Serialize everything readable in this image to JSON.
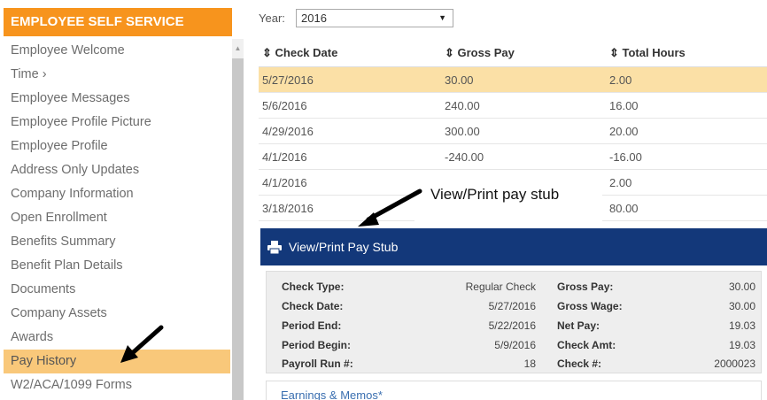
{
  "sidebar": {
    "title": "EMPLOYEE SELF SERVICE",
    "items": [
      {
        "label": "Employee Welcome"
      },
      {
        "label": "Time ›"
      },
      {
        "label": "Employee Messages"
      },
      {
        "label": "Employee Profile Picture"
      },
      {
        "label": "Employee Profile"
      },
      {
        "label": "Address Only Updates"
      },
      {
        "label": "Company Information"
      },
      {
        "label": "Open Enrollment"
      },
      {
        "label": "Benefits Summary"
      },
      {
        "label": "Benefit Plan Details"
      },
      {
        "label": "Documents"
      },
      {
        "label": "Company Assets"
      },
      {
        "label": "Awards"
      },
      {
        "label": "Pay History"
      },
      {
        "label": "W2/ACA/1099 Forms"
      }
    ],
    "active_index": 13
  },
  "filter": {
    "year_label": "Year:",
    "year_value": "2016"
  },
  "table": {
    "headers": [
      "⇕ Check Date",
      "⇕ Gross Pay",
      "⇕ Total Hours"
    ],
    "rows": [
      {
        "date": "5/27/2016",
        "gross": "30.00",
        "hours": "2.00"
      },
      {
        "date": "5/6/2016",
        "gross": "240.00",
        "hours": "16.00"
      },
      {
        "date": "4/29/2016",
        "gross": "300.00",
        "hours": "20.00"
      },
      {
        "date": "4/1/2016",
        "gross": "-240.00",
        "hours": "-16.00"
      },
      {
        "date": "4/1/2016",
        "gross": "",
        "hours": "2.00"
      },
      {
        "date": "3/18/2016",
        "gross": "",
        "hours": "80.00"
      }
    ]
  },
  "callout": {
    "text": "View/Print pay stub"
  },
  "stub": {
    "button_label": "View/Print Pay Stub"
  },
  "details": {
    "left": [
      {
        "label": "Check Type:",
        "value": "Regular Check"
      },
      {
        "label": "Check Date:",
        "value": "5/27/2016"
      },
      {
        "label": "Period End:",
        "value": "5/22/2016"
      },
      {
        "label": "Period Begin:",
        "value": "5/9/2016"
      },
      {
        "label": "Payroll Run #:",
        "value": "18"
      }
    ],
    "right": [
      {
        "label": "Gross Pay:",
        "value": "30.00"
      },
      {
        "label": "Gross Wage:",
        "value": "30.00"
      },
      {
        "label": "Net Pay:",
        "value": "19.03"
      },
      {
        "label": "Check Amt:",
        "value": "19.03"
      },
      {
        "label": "Check #:",
        "value": "2000023"
      }
    ]
  },
  "earnings": {
    "label": "Earnings & Memos*"
  },
  "colors": {
    "sidebar_title_bg": "#f7941d",
    "active_item_bg": "#f9c87a",
    "row_highlight": "#fbe0a6",
    "stub_bar_bg": "#13387a"
  },
  "icons": {
    "print": "printer-icon"
  }
}
